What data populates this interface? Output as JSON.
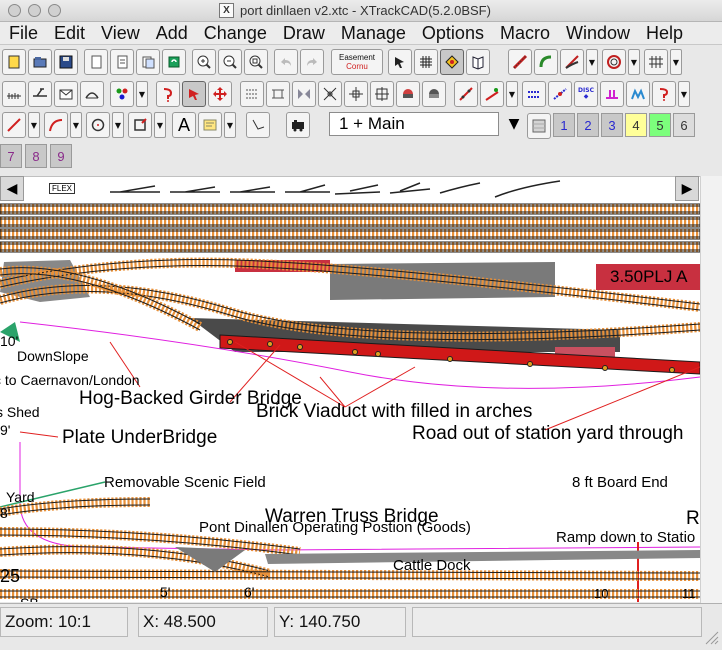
{
  "window": {
    "title": "port dinllaen v2.xtc - XTrackCAD(5.2.0BSF)",
    "x11_badge": "X"
  },
  "menu": [
    "File",
    "Edit",
    "View",
    "Add",
    "Change",
    "Draw",
    "Manage",
    "Options",
    "Macro",
    "Window",
    "Help"
  ],
  "toolbar": {
    "easement_line1": "Easement",
    "easement_line2": "Cornu",
    "text_tool": "A",
    "layer_select": "1 + Main",
    "layer_buttons": [
      {
        "label": "1",
        "color": "#c8c8c8"
      },
      {
        "label": "2",
        "color": "#c8c8c8"
      },
      {
        "label": "3",
        "color": "#c8c8c8"
      },
      {
        "label": "4",
        "color": "#ffff99"
      },
      {
        "label": "5",
        "color": "#7cff7c"
      },
      {
        "label": "6",
        "color": "#dcdcdc"
      },
      {
        "label": "7",
        "color": "#c8c8c8"
      },
      {
        "label": "8",
        "color": "#c8c8c8"
      },
      {
        "label": "9",
        "color": "#c8c8c8"
      }
    ]
  },
  "hotbar": {
    "flex_label": "FLEX"
  },
  "canvas": {
    "sign": "3.50PLJ A",
    "labels": {
      "downslope": "DownSlope",
      "caernavon": "c to Caernavon/London",
      "hog_backed": "Hog-Backed Girder Bridge",
      "shed": "s Shed",
      "brick_viaduct": "Brick Viaduct with filled in arches",
      "road": "Road out of station yard through",
      "plate": "Plate UnderBridge",
      "scenic": "Removable Scenic Field",
      "board_end": "8 ft Board End",
      "yard": "Yard",
      "warren": "Warren Truss Bridge",
      "operating": "Pont Dinallen Operating Postion (Goods)",
      "ramp": "Ramp down to Statio",
      "cattle": "Cattle Dock",
      "r_cut": "R",
      "sb": "SB"
    },
    "ruler": {
      "m10": "10'",
      "m9": "9'",
      "m8": "8'",
      "m25": "25",
      "m5": "5'",
      "m6": "6'",
      "m10b": "10",
      "m11": "11"
    }
  },
  "status": {
    "zoom": "Zoom: 10:1",
    "x": "X: 48.500",
    "y": "Y: 140.750"
  },
  "colors": {
    "track_tie": "#e8913a",
    "track_rail": "#1a1a1a",
    "viaduct": "#d01818",
    "platform": "#888888",
    "leader": "#e02020",
    "magenta_line": "#e020e0",
    "scenic_line": "#2aa36a"
  }
}
